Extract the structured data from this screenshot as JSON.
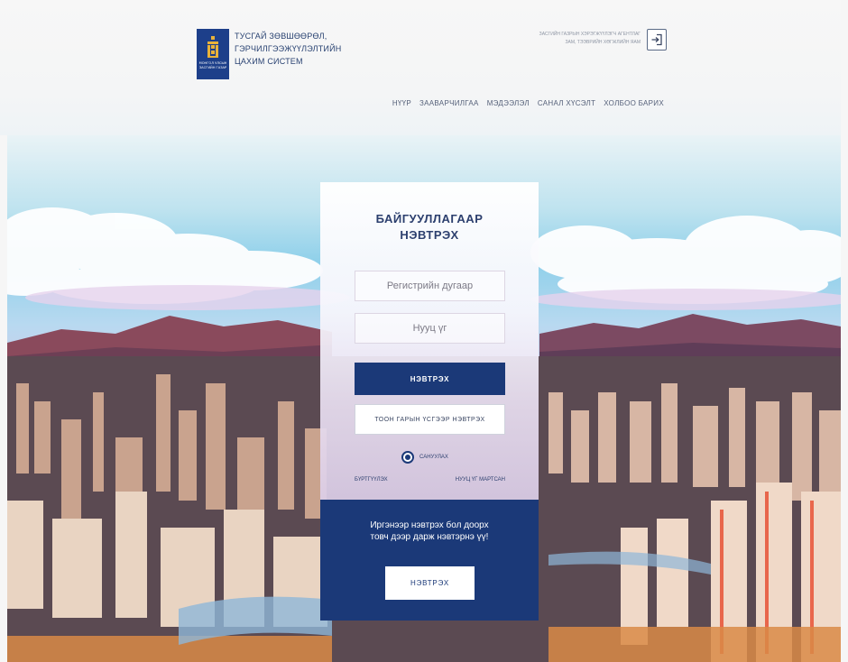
{
  "header": {
    "brand_lines": [
      "ТУСГАЙ ЗӨВШӨӨРӨЛ,",
      "ГЭРЧИЛГЭЭЖҮҮЛЭЛТИЙН",
      "ЦАХИМ СИСТЕМ"
    ],
    "logo_caption": "МОНГОЛ УЛСЫН ЗАСГИЙН ГАЗАР",
    "org_note_lines": [
      "ЗАСГИЙН ГАЗРЫН ХЭРЭГЖҮҮЛЭГЧ АГЕНТЛАГ",
      "ЗАМ, ТЭЭВРИЙН ХӨГЖЛИЙН ЯАМ"
    ],
    "login_icon": "sign-in-icon"
  },
  "nav": {
    "items": [
      "НҮҮР",
      "ЗААВАРЧИЛГАА",
      "МЭДЭЭЛЭЛ",
      "САНАЛ ХҮСЭЛТ",
      "ХОЛБОО БАРИХ"
    ]
  },
  "login": {
    "title_line1": "БАЙГУУЛЛАГААР",
    "title_line2": "НЭВТРЭХ",
    "register_placeholder": "Регистрийн дугаар",
    "password_placeholder": "Нууц үг",
    "submit_label": "НЭВТРЭХ",
    "digital_sign_label": "ТООН ГАРЫН ҮСГЭЭР НЭВТРЭХ",
    "remember_label": "САНУУЛАХ",
    "register_link": "БҮРТГҮҮЛЭХ",
    "forgot_link": "НУУЦ ҮГ МАРТСАН"
  },
  "citizen": {
    "message_line1": "Иргэнээр нэвтрэх бол доорх",
    "message_line2": "товч дээр дарж нэвтэрнэ үү!",
    "button_label": "НЭВТРЭХ"
  },
  "colors": {
    "brand": "#1b3978",
    "text_primary": "#2c3f6e"
  }
}
